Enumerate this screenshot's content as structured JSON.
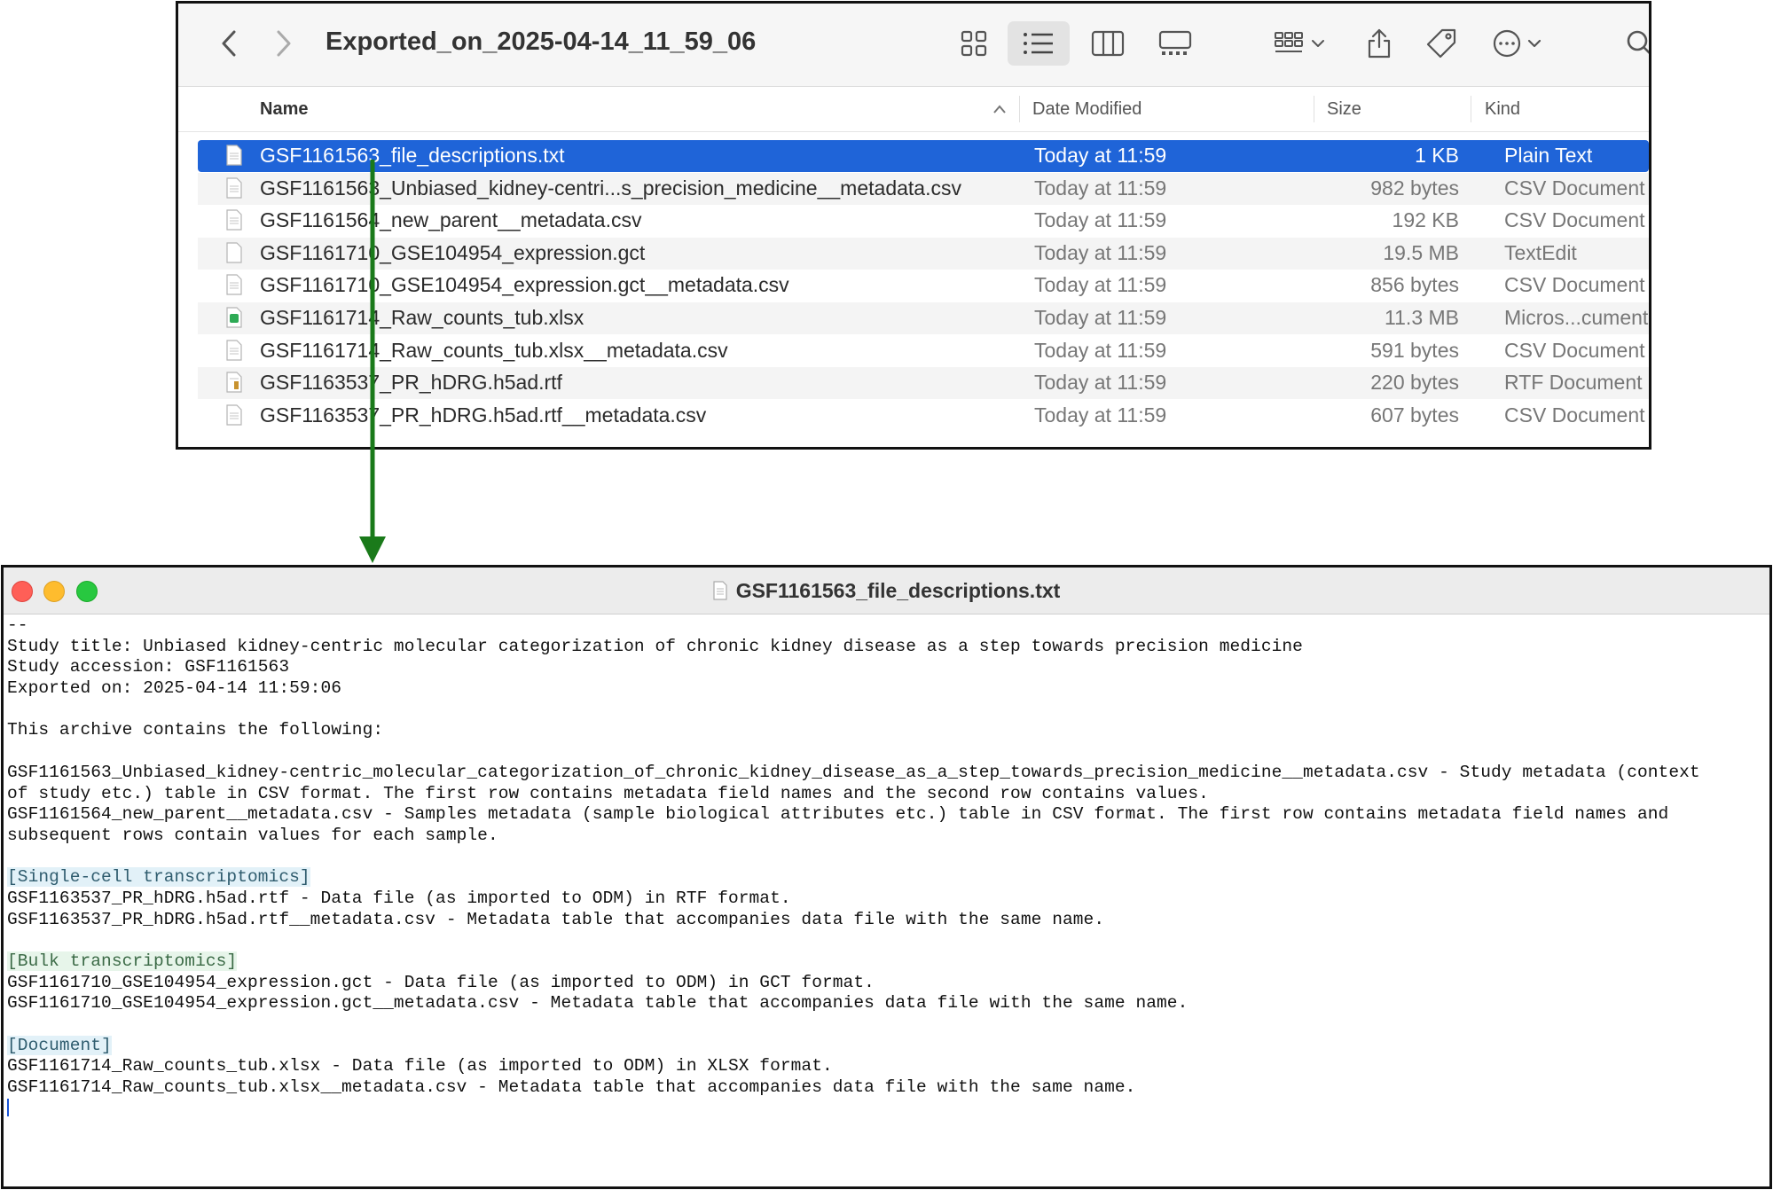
{
  "finder": {
    "title": "Exported_on_2025-04-14_11_59_06",
    "columns": {
      "name": "Name",
      "date": "Date Modified",
      "size": "Size",
      "kind": "Kind"
    },
    "files": [
      {
        "name": "GSF1161563_file_descriptions.txt",
        "date": "Today at 11:59",
        "size": "1 KB",
        "kind": "Plain Text",
        "icon": "text-file-icon",
        "selected": true
      },
      {
        "name": "GSF1161563_Unbiased_kidney-centri...s_precision_medicine__metadata.csv",
        "date": "Today at 11:59",
        "size": "982 bytes",
        "kind": "CSV Document",
        "icon": "csv-file-icon"
      },
      {
        "name": "GSF1161564_new_parent__metadata.csv",
        "date": "Today at 11:59",
        "size": "192 KB",
        "kind": "CSV Document",
        "icon": "csv-file-icon"
      },
      {
        "name": "GSF1161710_GSE104954_expression.gct",
        "date": "Today at 11:59",
        "size": "19.5 MB",
        "kind": "TextEdit",
        "icon": "blank-file-icon"
      },
      {
        "name": "GSF1161710_GSE104954_expression.gct__metadata.csv",
        "date": "Today at 11:59",
        "size": "856 bytes",
        "kind": "CSV Document",
        "icon": "csv-file-icon"
      },
      {
        "name": "GSF1161714_Raw_counts_tub.xlsx",
        "date": "Today at 11:59",
        "size": "11.3 MB",
        "kind": "Micros...cument",
        "icon": "excel-file-icon"
      },
      {
        "name": "GSF1161714_Raw_counts_tub.xlsx__metadata.csv",
        "date": "Today at 11:59",
        "size": "591 bytes",
        "kind": "CSV Document",
        "icon": "csv-file-icon"
      },
      {
        "name": "GSF1163537_PR_hDRG.h5ad.rtf",
        "date": "Today at 11:59",
        "size": "220 bytes",
        "kind": "RTF Document",
        "icon": "rtf-file-icon"
      },
      {
        "name": "GSF1163537_PR_hDRG.h5ad.rtf__metadata.csv",
        "date": "Today at 11:59",
        "size": "607 bytes",
        "kind": "CSV Document",
        "icon": "csv-file-icon"
      }
    ]
  },
  "textedit": {
    "title": "GSF1161563_file_descriptions.txt",
    "lines": [
      {
        "text": "--"
      },
      {
        "text": "Study title: Unbiased kidney-centric molecular categorization of chronic kidney disease as a step towards precision medicine"
      },
      {
        "text": "Study accession: GSF1161563"
      },
      {
        "text": "Exported on: 2025-04-14 11:59:06"
      },
      {
        "text": ""
      },
      {
        "text": "This archive contains the following:"
      },
      {
        "text": ""
      },
      {
        "text": "GSF1161563_Unbiased_kidney-centric_molecular_categorization_of_chronic_kidney_disease_as_a_step_towards_precision_medicine__metadata.csv - Study metadata (context"
      },
      {
        "text": "of study etc.) table in CSV format. The first row contains metadata field names and the second row contains values."
      },
      {
        "text": "GSF1161564_new_parent__metadata.csv - Samples metadata (sample biological attributes etc.) table in CSV format. The first row contains metadata field names and"
      },
      {
        "text": "subsequent rows contain values for each sample."
      },
      {
        "text": ""
      },
      {
        "text": "[Single-cell transcriptomics]",
        "highlight": "blue"
      },
      {
        "text": "GSF1163537_PR_hDRG.h5ad.rtf - Data file (as imported to ODM) in RTF format."
      },
      {
        "text": "GSF1163537_PR_hDRG.h5ad.rtf__metadata.csv - Metadata table that accompanies data file with the same name."
      },
      {
        "text": ""
      },
      {
        "text": "[Bulk transcriptomics]",
        "highlight": "green"
      },
      {
        "text": "GSF1161710_GSE104954_expression.gct - Data file (as imported to ODM) in GCT format."
      },
      {
        "text": "GSF1161710_GSE104954_expression.gct__metadata.csv - Metadata table that accompanies data file with the same name."
      },
      {
        "text": ""
      },
      {
        "text": "[Document]",
        "highlight": "blue"
      },
      {
        "text": "GSF1161714_Raw_counts_tub.xlsx - Data file (as imported to ODM) in XLSX format."
      },
      {
        "text": "GSF1161714_Raw_counts_tub.xlsx__metadata.csv - Metadata table that accompanies data file with the same name."
      }
    ]
  },
  "colors": {
    "selection": "#1f64d8",
    "arrow": "#1a7a1a",
    "close": "#ff5f57",
    "minimize": "#febc2e",
    "zoom": "#28c840"
  }
}
